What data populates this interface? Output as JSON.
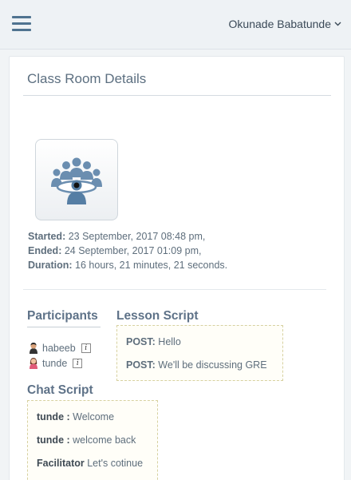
{
  "header": {
    "user_name": "Okunade Babatunde",
    "menu_icon": "hamburger-icon",
    "chevron_icon": "chevron-down-icon"
  },
  "page": {
    "title": "Class Room Details"
  },
  "session": {
    "started_label": "Started:",
    "started_value": "23 September, 2017 08:48 pm,",
    "ended_label": "Ended:",
    "ended_value": "24 September, 2017 01:09 pm,",
    "duration_label": "Duration:",
    "duration_value": "16 hours, 21 minutes, 21 seconds."
  },
  "participants": {
    "title": "Participants",
    "items": [
      {
        "name": "habeeb",
        "info": "i"
      },
      {
        "name": "tunde",
        "info": "i"
      }
    ]
  },
  "lesson_script": {
    "title": "Lesson Script",
    "lines": [
      {
        "label": "POST:",
        "text": "Hello"
      },
      {
        "label": "POST:",
        "text": "We'll be discussing GRE"
      }
    ]
  },
  "chat_script": {
    "title": "Chat Script",
    "lines": [
      {
        "speaker": "tunde :",
        "text": "Welcome"
      },
      {
        "speaker": "tunde :",
        "text": "welcome back"
      },
      {
        "speaker": "Facilitator",
        "text": "Let's cotinue"
      }
    ]
  },
  "colors": {
    "accent": "#4f7390",
    "section_title": "#5e7288",
    "script_border": "#d7d1a0"
  }
}
